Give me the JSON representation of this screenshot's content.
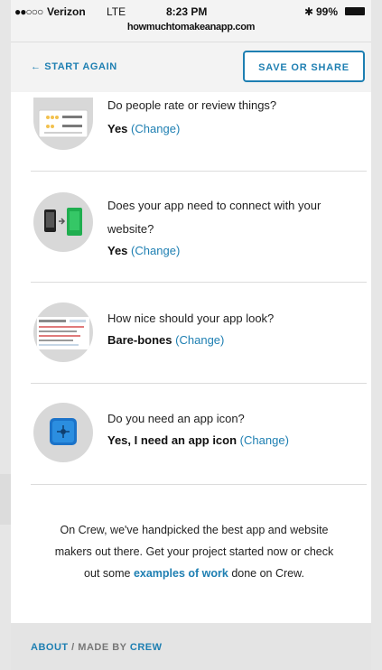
{
  "status": {
    "signal": "●●○○○",
    "carrier": "Verizon",
    "network": "LTE",
    "time": "8:23 PM",
    "bluetooth": "✱",
    "battery": "99%"
  },
  "browser": {
    "url": "howmuchtomakeanapp.com"
  },
  "nav": {
    "start_again": "← START AGAIN",
    "save_or_share": "SAVE OR SHARE"
  },
  "questions": [
    {
      "icon": "rating-icon",
      "question": "Do people rate or review things?",
      "answer": "Yes",
      "change": "Change"
    },
    {
      "icon": "connect-website-icon",
      "question": "Does your app need to connect with your website?",
      "answer": "Yes",
      "change": "Change"
    },
    {
      "icon": "design-icon",
      "question": "How nice should your app look?",
      "answer": "Bare-bones",
      "change": "Change"
    },
    {
      "icon": "app-icon-icon",
      "question": "Do you need an app icon?",
      "answer": "Yes, I need an app icon",
      "change": "Change"
    }
  ],
  "footer": {
    "text_before": "On Crew, we've handpicked the best app and website makers out there. Get your project started now or check out some ",
    "link": "examples of work",
    "text_after": " done on Crew.",
    "about": "ABOUT",
    "separator": "/",
    "made_by": "MADE BY",
    "crew": "CREW"
  },
  "colors": {
    "accent": "#1e7fb2",
    "green": "#1fae4f"
  }
}
